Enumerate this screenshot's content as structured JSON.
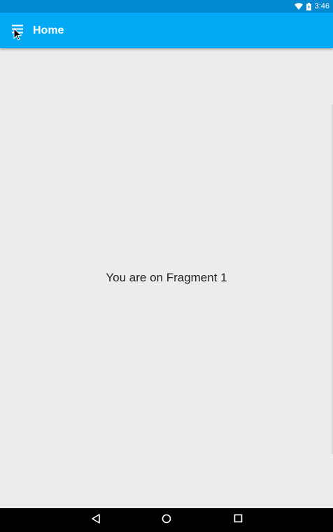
{
  "status_bar": {
    "time": "3:46",
    "icons": [
      "wifi-icon",
      "battery-icon"
    ],
    "color": "#0288d1"
  },
  "app_bar": {
    "title": "Home",
    "menu_icon": "hamburger-menu-icon",
    "color": "#03a9f4"
  },
  "content": {
    "message": "You are on Fragment 1",
    "background": "#ececec"
  },
  "nav_bar": {
    "buttons": [
      "back-icon",
      "home-icon",
      "recents-icon"
    ]
  }
}
